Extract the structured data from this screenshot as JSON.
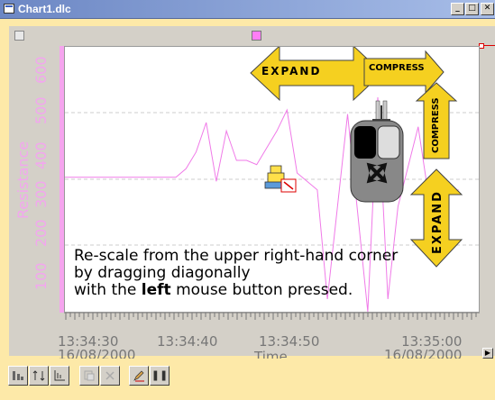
{
  "window": {
    "title": "Chart1.dlc",
    "minimize_glyph": "_",
    "maximize_glyph": "□",
    "close_glyph": "✕"
  },
  "chart": {
    "y_axis_label": "Resistance",
    "y_ticks": [
      "100",
      "200",
      "300",
      "400",
      "500",
      "600"
    ],
    "x_ticks": [
      {
        "time": "13:34:30",
        "date": "16/08/2000"
      },
      {
        "time": "13:34:40",
        "date": ""
      },
      {
        "time": "13:34:50",
        "date": ""
      },
      {
        "time": "13:35:00",
        "date": "16/08/2000"
      }
    ],
    "x_axis_label": "Time",
    "series_color": "#f07ae8"
  },
  "chart_data": {
    "type": "line",
    "title": "",
    "xlabel": "Time",
    "ylabel": "Resistance",
    "ylim": [
      50,
      680
    ],
    "x": [
      "13:34:25",
      "13:34:28",
      "13:34:30",
      "13:34:32",
      "13:34:34",
      "13:34:36",
      "13:34:37",
      "13:34:38",
      "13:34:39",
      "13:34:40",
      "13:34:41",
      "13:34:42",
      "13:34:43",
      "13:34:44",
      "13:34:46",
      "13:34:47",
      "13:34:48",
      "13:34:50",
      "13:34:51",
      "13:34:52",
      "13:34:53",
      "13:34:55",
      "13:34:56",
      "13:34:57",
      "13:34:58",
      "13:35:00",
      "13:35:01",
      "13:35:02",
      "13:35:04"
    ],
    "series": [
      {
        "values": [
          370,
          370,
          370,
          370,
          370,
          370,
          390,
          430,
          500,
          360,
          480,
          410,
          410,
          400,
          480,
          530,
          380,
          340,
          80,
          300,
          520,
          50,
          560,
          80,
          300,
          490,
          330,
          330,
          340
        ]
      }
    ]
  },
  "overlay": {
    "caption_line1": "Re-scale from the upper right-hand corner",
    "caption_line2": "by dragging diagonally",
    "caption_line3_prefix": "with the",
    "caption_line3_bold": "left",
    "caption_line3_suffix": "mouse button pressed.",
    "expand_horizontal": "EXPAND",
    "compress_horizontal": "COMPRESS",
    "compress_vertical": "COMPRESS",
    "expand_vertical": "EXPAND",
    "arrow_color": "#f5d020"
  },
  "toolbar": {
    "buttons": [
      "chart-view",
      "swap-axes",
      "axis-settings",
      "copy",
      "delete",
      "edit",
      "pause"
    ],
    "pause_glyph": "❚❚"
  }
}
